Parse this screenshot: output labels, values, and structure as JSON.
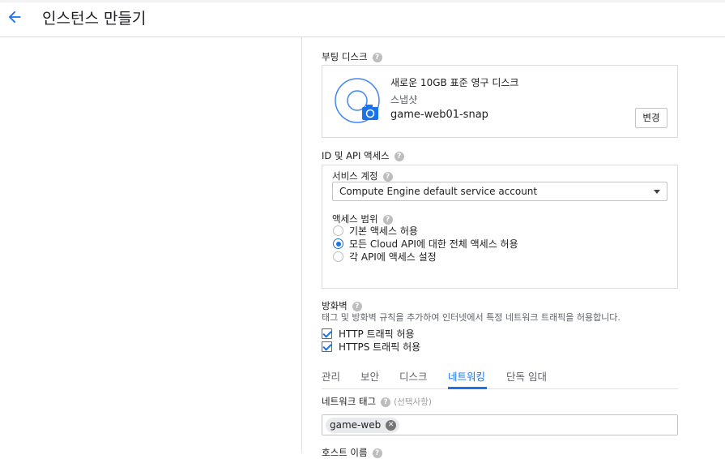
{
  "header": {
    "title": "인스턴스 만들기"
  },
  "boot_disk": {
    "label": "부팅 디스크",
    "line1": "새로운 10GB 표준 영구 디스크",
    "line2": "스냅샷",
    "snapshot_name": "game-web01-snap",
    "change_label": "변경"
  },
  "identity": {
    "label": "ID 및 API 액세스",
    "service_account_label": "서비스 계정",
    "service_account_value": "Compute Engine default service account",
    "access_scope_label": "액세스 범위",
    "scopes": [
      {
        "label": "기본 액세스 허용",
        "selected": false
      },
      {
        "label": "모든 Cloud API에 대한 전체 액세스 허용",
        "selected": true
      },
      {
        "label": "각 API에 액세스 설정",
        "selected": false
      }
    ]
  },
  "firewall": {
    "label": "방화벽",
    "description": "태그 및 방화벽 규칙을 추가하여 인터넷에서 특정 네트워크 트래픽을 허용합니다.",
    "http_label": "HTTP 트래픽 허용",
    "https_label": "HTTPS 트래픽 허용",
    "http_checked": true,
    "https_checked": true
  },
  "tabs": [
    {
      "label": "관리",
      "active": false
    },
    {
      "label": "보안",
      "active": false
    },
    {
      "label": "디스크",
      "active": false
    },
    {
      "label": "네트워킹",
      "active": true
    },
    {
      "label": "단독 임대",
      "active": false
    }
  ],
  "network_tags": {
    "label": "네트워크 태그",
    "optional": "(선택사항)",
    "chip": "game-web"
  },
  "hostname": {
    "label": "호스트 이름"
  },
  "help_glyph": "?",
  "chip_remove_glyph": "✕",
  "colors": {
    "accent": "#1a73e8",
    "help": "#bdbdbd"
  }
}
